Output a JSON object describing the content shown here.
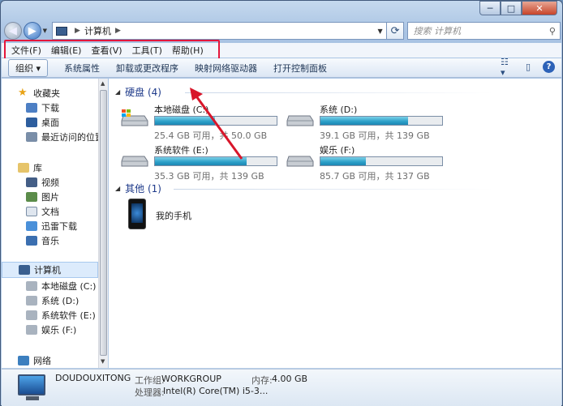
{
  "window": {
    "title": "计算机"
  },
  "title_buttons": {
    "minimize": "─",
    "maximize": "□",
    "close": "✕"
  },
  "address": {
    "path": "计算机",
    "search_placeholder": "搜索 计算机"
  },
  "menu": [
    "文件(F)",
    "编辑(E)",
    "查看(V)",
    "工具(T)",
    "帮助(H)"
  ],
  "toolbar": [
    "组织 ▾",
    "系统属性",
    "卸载或更改程序",
    "映射网络驱动器",
    "打开控制面板"
  ],
  "nav": {
    "favorites": {
      "label": "收藏夹",
      "items": [
        "下载",
        "桌面",
        "最近访问的位置"
      ]
    },
    "libraries": {
      "label": "库",
      "items": [
        "视频",
        "图片",
        "文档",
        "迅雷下载",
        "音乐"
      ]
    },
    "computer": {
      "label": "计算机",
      "items": [
        "本地磁盘 (C:)",
        "系统 (D:)",
        "系统软件 (E:)",
        "娱乐 (F:)"
      ]
    },
    "network": {
      "label": "网络"
    }
  },
  "groups": {
    "hard_disks": "硬盘 (4)",
    "other": "其他 (1)"
  },
  "drives": [
    {
      "name": "本地磁盘 (C:)",
      "info": "25.4 GB 可用，共 50.0 GB",
      "used_fraction": 0.49
    },
    {
      "name": "系统 (D:)",
      "info": "39.1 GB 可用，共 139 GB",
      "used_fraction": 0.72
    },
    {
      "name": "系统软件 (E:)",
      "info": "35.3 GB 可用，共 139 GB",
      "used_fraction": 0.75
    },
    {
      "name": "娱乐 (F:)",
      "info": "85.7 GB 可用，共 137 GB",
      "used_fraction": 0.37
    }
  ],
  "other_items": [
    {
      "name": "我的手机"
    }
  ],
  "details": {
    "computer_name": "DOUDOUXITONG",
    "workgroup_label": "工作组:",
    "workgroup": "WORKGROUP",
    "memory_label": "内存:",
    "memory": "4.00 GB",
    "processor_label": "处理器:",
    "processor": "Intel(R) Core(TM) i5-3..."
  },
  "colors": {
    "annotation": "#e5163c",
    "accent": "#2b9fc8"
  }
}
